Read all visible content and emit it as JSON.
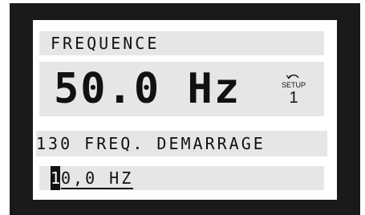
{
  "display": {
    "title": "FREQUENCE",
    "value": "50.0 Hz",
    "setup_label": "SETUP",
    "setup_number": "1",
    "parameter": "130 FREQ. DEMARRAGE",
    "edit_cursor": "1",
    "edit_value": "0,0 HZ"
  },
  "colors": {
    "bezel": "#1a1a1a",
    "lcd_background": "#e6e6e6",
    "lcd_text": "#111111"
  },
  "icons": {
    "setup": "setup-rotate-icon"
  }
}
